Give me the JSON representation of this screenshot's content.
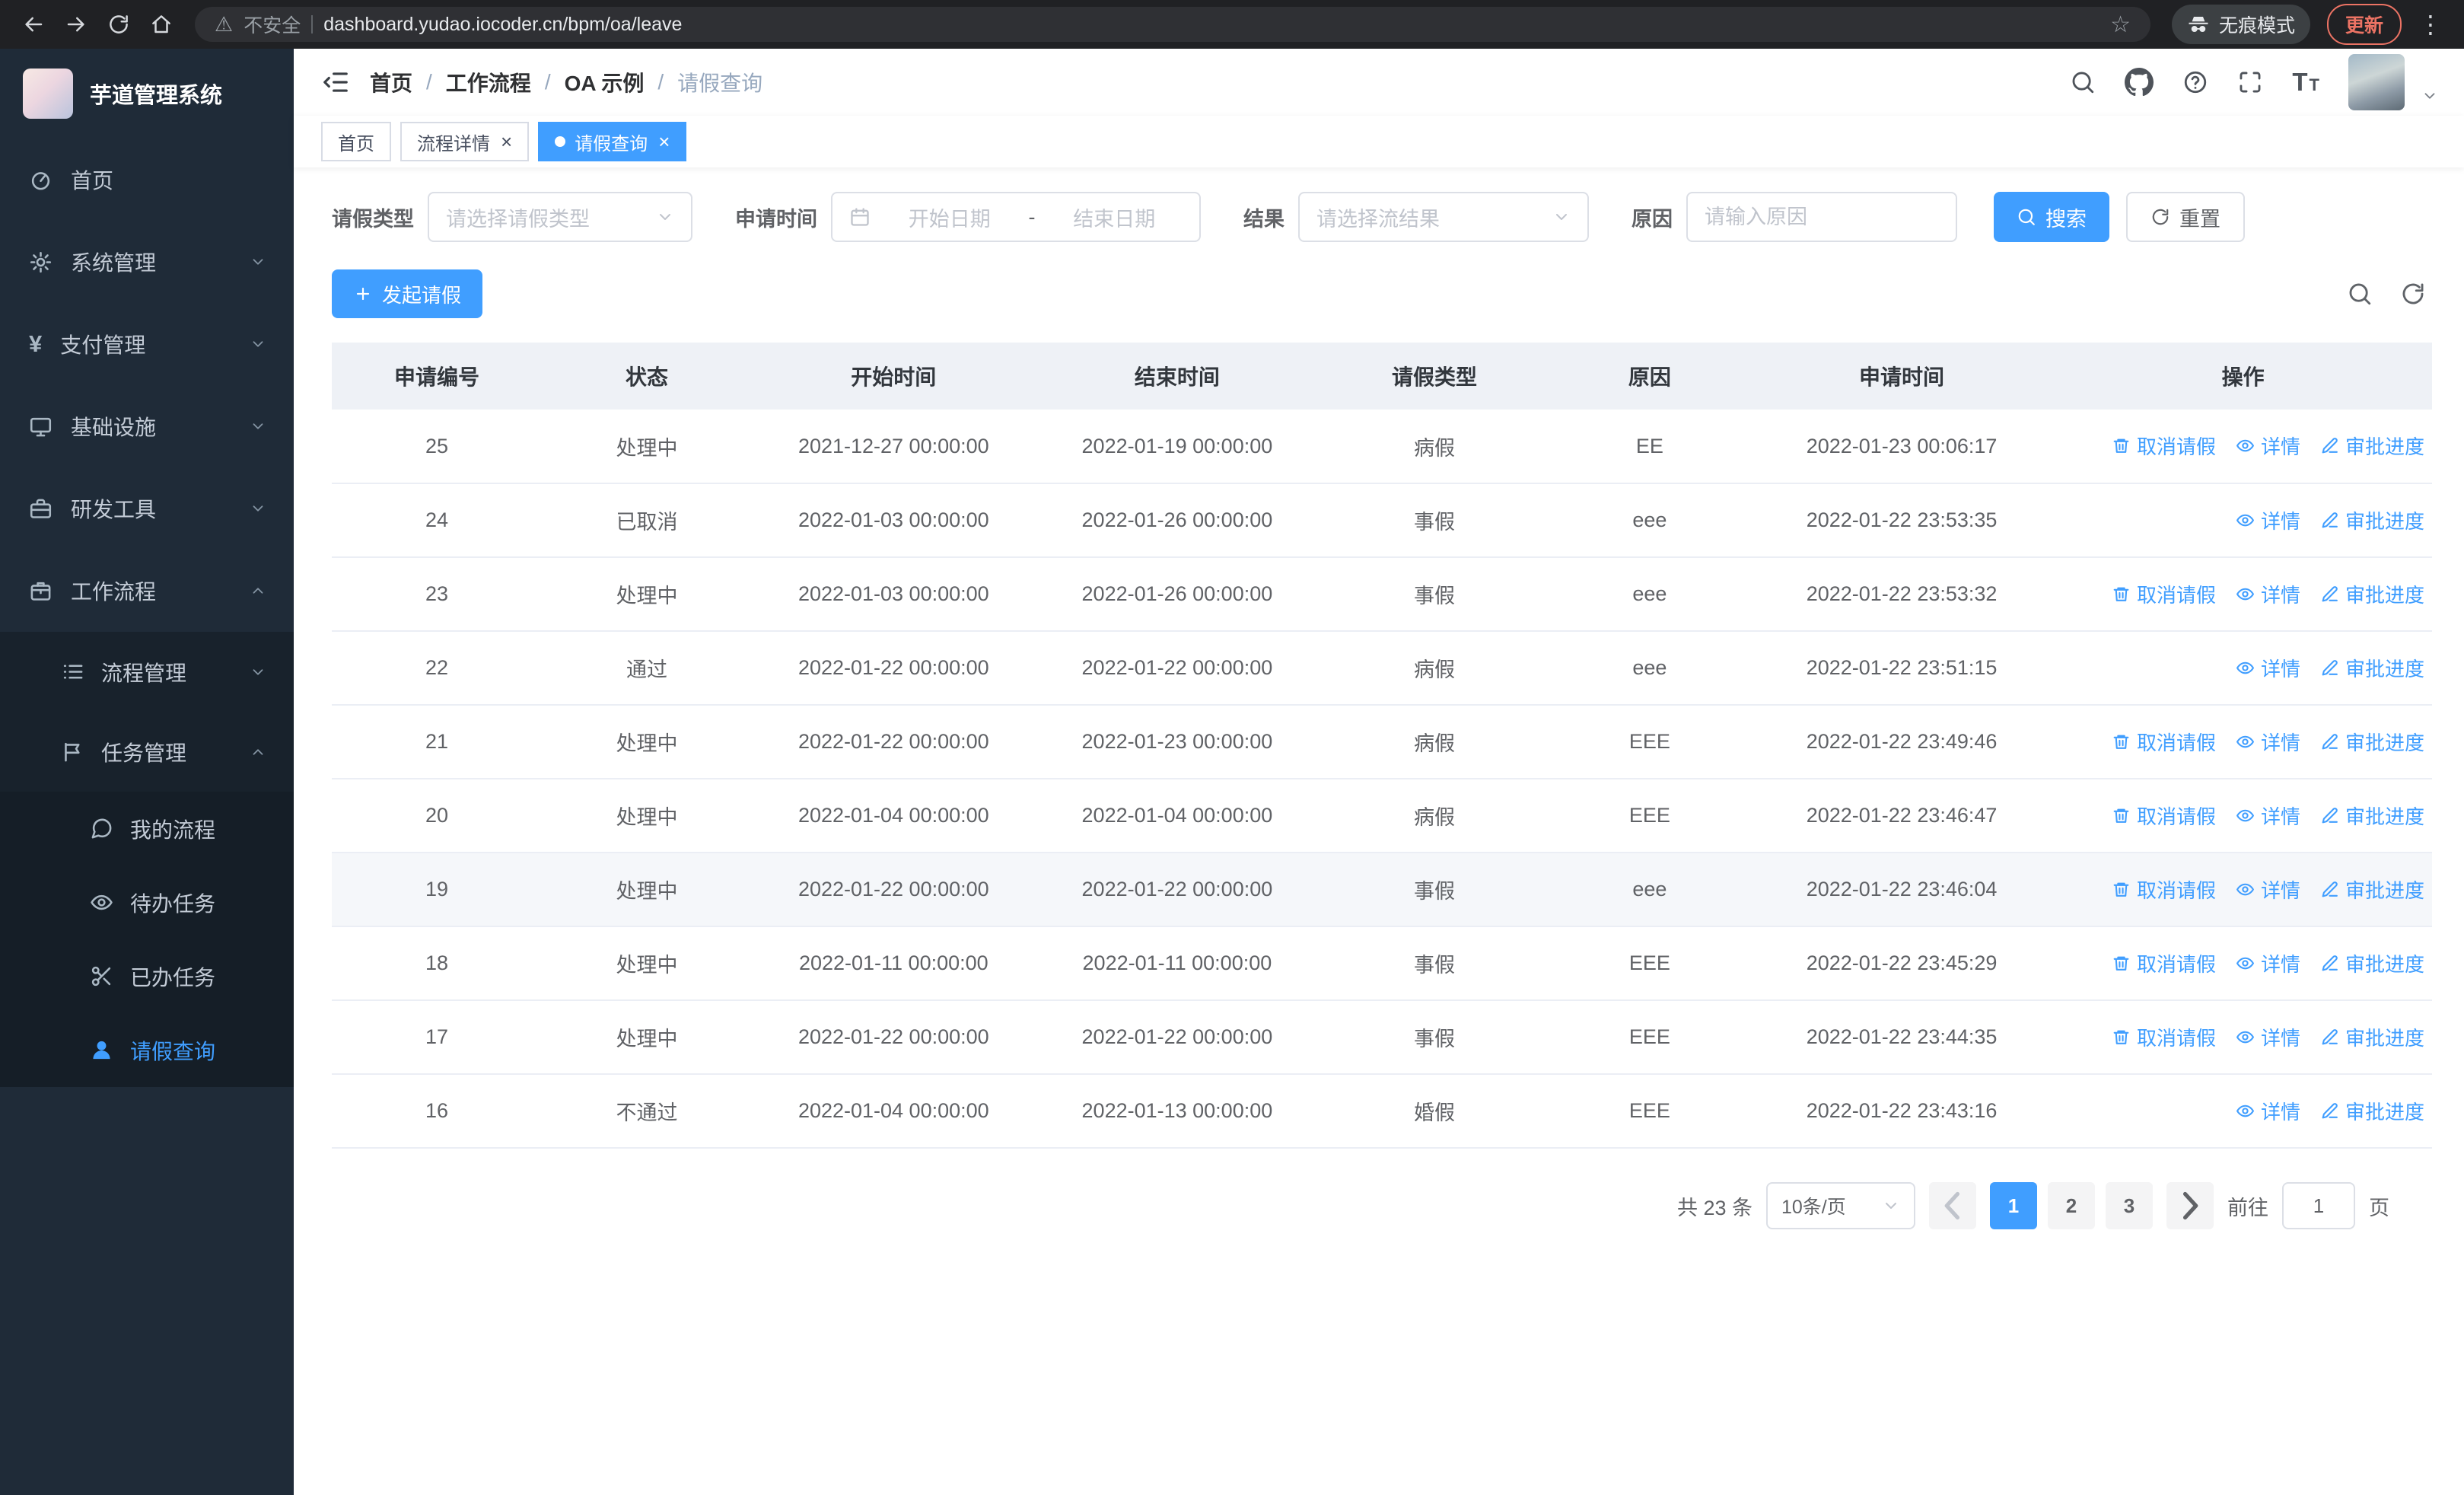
{
  "browser": {
    "security_label": "不安全",
    "url": "dashboard.yudao.iocoder.cn/bpm/oa/leave",
    "incognito_label": "无痕模式",
    "update_label": "更新"
  },
  "sidebar": {
    "app_title": "芋道管理系统",
    "menu": [
      {
        "key": "home",
        "label": "首页",
        "icon": "dashboard-icon"
      },
      {
        "key": "system-management",
        "label": "系统管理",
        "icon": "gear-icon",
        "chevron": "down"
      },
      {
        "key": "payment-management",
        "label": "支付管理",
        "icon": "yen-icon",
        "chevron": "down"
      },
      {
        "key": "infrastructure",
        "label": "基础设施",
        "icon": "monitor-icon",
        "chevron": "down"
      },
      {
        "key": "dev-tools",
        "label": "研发工具",
        "icon": "briefcase-icon",
        "chevron": "down"
      },
      {
        "key": "workflow",
        "label": "工作流程",
        "icon": "suitcase-icon",
        "chevron": "up",
        "expanded": true,
        "children": [
          {
            "key": "process-management",
            "label": "流程管理",
            "icon": "list-icon",
            "chevron": "down"
          },
          {
            "key": "task-management",
            "label": "任务管理",
            "icon": "flag-icon",
            "chevron": "up",
            "expanded": true,
            "children": [
              {
                "key": "my-processes",
                "label": "我的流程",
                "icon": "message-icon"
              },
              {
                "key": "todo-tasks",
                "label": "待办任务",
                "icon": "eye-icon"
              },
              {
                "key": "done-tasks",
                "label": "已办任务",
                "icon": "scissors-icon"
              },
              {
                "key": "leave-query",
                "label": "请假查询",
                "icon": "user-icon",
                "active": true
              }
            ]
          }
        ]
      }
    ]
  },
  "header": {
    "breadcrumb": [
      {
        "label": "首页"
      },
      {
        "label": "工作流程"
      },
      {
        "label": "OA 示例"
      },
      {
        "label": "请假查询",
        "current": true
      }
    ]
  },
  "tabs": [
    {
      "key": "home",
      "label": "首页"
    },
    {
      "key": "process-detail",
      "label": "流程详情",
      "closable": true
    },
    {
      "key": "leave-query",
      "label": "请假查询",
      "closable": true,
      "active": true
    }
  ],
  "filters": {
    "leave_type_label": "请假类型",
    "leave_type_placeholder": "请选择请假类型",
    "apply_time_label": "申请时间",
    "start_date_placeholder": "开始日期",
    "range_separator": "-",
    "end_date_placeholder": "结束日期",
    "result_label": "结果",
    "result_placeholder": "请选择流结果",
    "reason_label": "原因",
    "reason_placeholder": "请输入原因",
    "search_label": "搜索",
    "reset_label": "重置"
  },
  "toolbar": {
    "create_label": "发起请假"
  },
  "table": {
    "columns": [
      "申请编号",
      "状态",
      "开始时间",
      "结束时间",
      "请假类型",
      "原因",
      "申请时间",
      "操作"
    ],
    "action_labels": {
      "cancel": "取消请假",
      "detail": "详情",
      "progress": "审批进度"
    },
    "rows": [
      {
        "id": "25",
        "status": "处理中",
        "start": "2021-12-27 00:00:00",
        "end": "2022-01-19 00:00:00",
        "type": "病假",
        "reason": "EE",
        "apply": "2022-01-23 00:06:17",
        "actions": [
          "cancel",
          "detail",
          "progress"
        ]
      },
      {
        "id": "24",
        "status": "已取消",
        "start": "2022-01-03 00:00:00",
        "end": "2022-01-26 00:00:00",
        "type": "事假",
        "reason": "eee",
        "apply": "2022-01-22 23:53:35",
        "actions": [
          "detail",
          "progress"
        ]
      },
      {
        "id": "23",
        "status": "处理中",
        "start": "2022-01-03 00:00:00",
        "end": "2022-01-26 00:00:00",
        "type": "事假",
        "reason": "eee",
        "apply": "2022-01-22 23:53:32",
        "actions": [
          "cancel",
          "detail",
          "progress"
        ]
      },
      {
        "id": "22",
        "status": "通过",
        "start": "2022-01-22 00:00:00",
        "end": "2022-01-22 00:00:00",
        "type": "病假",
        "reason": "eee",
        "apply": "2022-01-22 23:51:15",
        "actions": [
          "detail",
          "progress"
        ]
      },
      {
        "id": "21",
        "status": "处理中",
        "start": "2022-01-22 00:00:00",
        "end": "2022-01-23 00:00:00",
        "type": "病假",
        "reason": "EEE",
        "apply": "2022-01-22 23:49:46",
        "actions": [
          "cancel",
          "detail",
          "progress"
        ]
      },
      {
        "id": "20",
        "status": "处理中",
        "start": "2022-01-04 00:00:00",
        "end": "2022-01-04 00:00:00",
        "type": "病假",
        "reason": "EEE",
        "apply": "2022-01-22 23:46:47",
        "actions": [
          "cancel",
          "detail",
          "progress"
        ]
      },
      {
        "id": "19",
        "status": "处理中",
        "start": "2022-01-22 00:00:00",
        "end": "2022-01-22 00:00:00",
        "type": "事假",
        "reason": "eee",
        "apply": "2022-01-22 23:46:04",
        "actions": [
          "cancel",
          "detail",
          "progress"
        ],
        "highlight": true
      },
      {
        "id": "18",
        "status": "处理中",
        "start": "2022-01-11 00:00:00",
        "end": "2022-01-11 00:00:00",
        "type": "事假",
        "reason": "EEE",
        "apply": "2022-01-22 23:45:29",
        "actions": [
          "cancel",
          "detail",
          "progress"
        ]
      },
      {
        "id": "17",
        "status": "处理中",
        "start": "2022-01-22 00:00:00",
        "end": "2022-01-22 00:00:00",
        "type": "事假",
        "reason": "EEE",
        "apply": "2022-01-22 23:44:35",
        "actions": [
          "cancel",
          "detail",
          "progress"
        ]
      },
      {
        "id": "16",
        "status": "不通过",
        "start": "2022-01-04 00:00:00",
        "end": "2022-01-13 00:00:00",
        "type": "婚假",
        "reason": "EEE",
        "apply": "2022-01-22 23:43:16",
        "actions": [
          "detail",
          "progress"
        ]
      }
    ]
  },
  "pagination": {
    "total_label": "共 23 条",
    "page_size_label": "10条/页",
    "pages": [
      "1",
      "2",
      "3"
    ],
    "active_page": "1",
    "goto_prefix": "前往",
    "goto_value": "1",
    "goto_suffix": "页"
  },
  "colors": {
    "accent": "#409eff",
    "sidebar_bg": "#1f2b38",
    "table_header_bg": "#eef1f6"
  }
}
